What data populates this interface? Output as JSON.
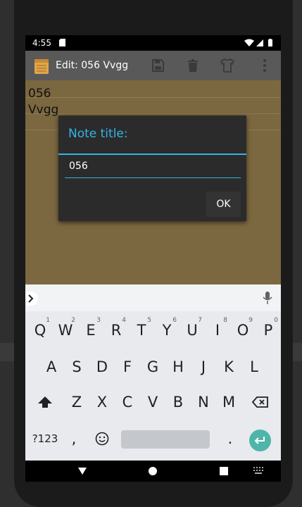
{
  "status_bar": {
    "time": "4:55"
  },
  "action_bar": {
    "title": "Edit: 056 Vvgg"
  },
  "note": {
    "line1": "056",
    "line2": "Vvgg"
  },
  "dialog": {
    "title": "Note title:",
    "input_value": "056",
    "ok_label": "OK"
  },
  "keyboard": {
    "row1": [
      {
        "k": "Q",
        "n": "1"
      },
      {
        "k": "W",
        "n": "2"
      },
      {
        "k": "E",
        "n": "3"
      },
      {
        "k": "R",
        "n": "4"
      },
      {
        "k": "T",
        "n": "5"
      },
      {
        "k": "Y",
        "n": "6"
      },
      {
        "k": "U",
        "n": "7"
      },
      {
        "k": "I",
        "n": "8"
      },
      {
        "k": "O",
        "n": "9"
      },
      {
        "k": "P",
        "n": "0"
      }
    ],
    "row2": [
      "A",
      "S",
      "D",
      "F",
      "G",
      "H",
      "J",
      "K",
      "L"
    ],
    "row3": [
      "Z",
      "X",
      "C",
      "V",
      "B",
      "N",
      "M"
    ],
    "symbols_label": "?123",
    "comma": ",",
    "period": "."
  },
  "colors": {
    "accent": "#33b5e5",
    "note_bg": "#7b6740",
    "enter_key": "#4fb5a8"
  }
}
